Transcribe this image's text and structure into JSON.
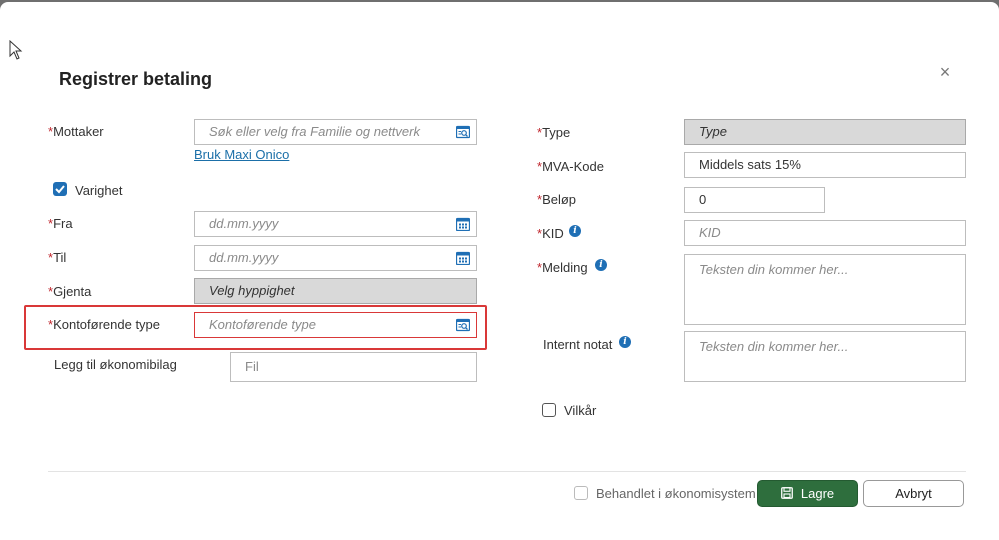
{
  "dialog": {
    "title": "Registrer betaling",
    "close_label": "×"
  },
  "left": {
    "mottaker": {
      "label": "Mottaker",
      "placeholder": "Søk eller velg fra Familie og nettverk",
      "link": "Bruk Maxi Onico"
    },
    "varighet": {
      "label": "Varighet",
      "checked": true
    },
    "fra": {
      "label": "Fra",
      "placeholder": "dd.mm.yyyy"
    },
    "til": {
      "label": "Til",
      "placeholder": "dd.mm.yyyy"
    },
    "gjenta": {
      "label": "Gjenta",
      "value": "Velg hyppighet"
    },
    "kontoforende": {
      "label": "Kontoførende type",
      "placeholder": "Kontoførende type"
    },
    "okonomibilag": {
      "label": "Legg til økonomibilag",
      "placeholder": "Fil"
    }
  },
  "right": {
    "type": {
      "label": "Type",
      "value": "Type"
    },
    "mva": {
      "label": "MVA-Kode",
      "value": "Middels sats 15%"
    },
    "belop": {
      "label": "Beløp",
      "value": "0"
    },
    "kid": {
      "label": "KID",
      "placeholder": "KID"
    },
    "melding": {
      "label": "Melding",
      "placeholder": "Teksten din kommer her..."
    },
    "internt_notat": {
      "label": "Internt notat",
      "placeholder": "Teksten din kommer her..."
    },
    "vilkar": {
      "label": "Vilkår",
      "checked": false
    }
  },
  "footer": {
    "behandlet": {
      "label": "Behandlet i økonomisystem",
      "checked": false
    },
    "save_label": "Lagre",
    "cancel_label": "Avbryt"
  },
  "colors": {
    "required": "#c0262d",
    "primary": "#2e6e3d",
    "link": "#1b6fa8",
    "highlight": "#d93838"
  }
}
